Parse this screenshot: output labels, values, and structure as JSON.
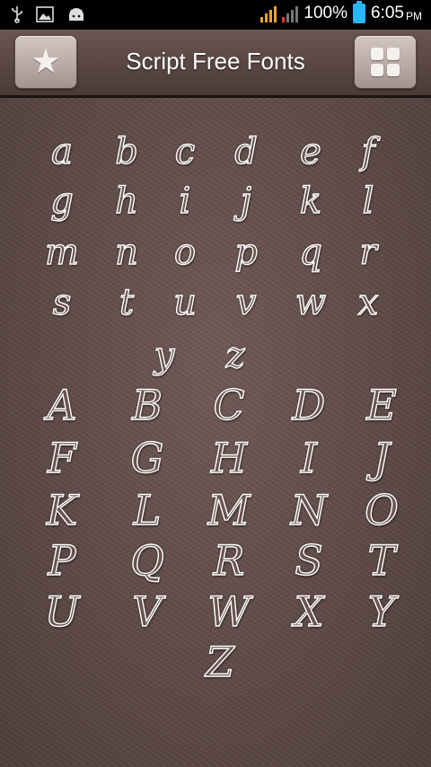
{
  "status_bar": {
    "battery_percent": "100%",
    "time": "6:05",
    "ampm": "PM"
  },
  "header": {
    "title": "Script Free Fonts",
    "favorites_icon": "star-icon",
    "grid_icon": "grid-icon"
  },
  "lowercase_rows": [
    [
      "a",
      "b",
      "c",
      "d",
      "e",
      "f"
    ],
    [
      "g",
      "h",
      "i",
      "j",
      "k",
      "l"
    ],
    [
      "m",
      "n",
      "o",
      "p",
      "q",
      "r"
    ],
    [
      "s",
      "t",
      "u",
      "v",
      "w",
      "x"
    ],
    [
      "y",
      "z"
    ]
  ],
  "uppercase_rows": [
    [
      "A",
      "B",
      "C",
      "D",
      "E"
    ],
    [
      "F",
      "G",
      "H",
      "I",
      "J"
    ],
    [
      "K",
      "L",
      "M",
      "N",
      "O"
    ],
    [
      "P",
      "Q",
      "R",
      "S",
      "T"
    ],
    [
      "U",
      "V",
      "W",
      "X",
      "Y"
    ],
    [
      "Z"
    ]
  ],
  "colors": {
    "background": "#5d4946",
    "letter_outline": "#ffffff",
    "header": "#5a4845"
  }
}
